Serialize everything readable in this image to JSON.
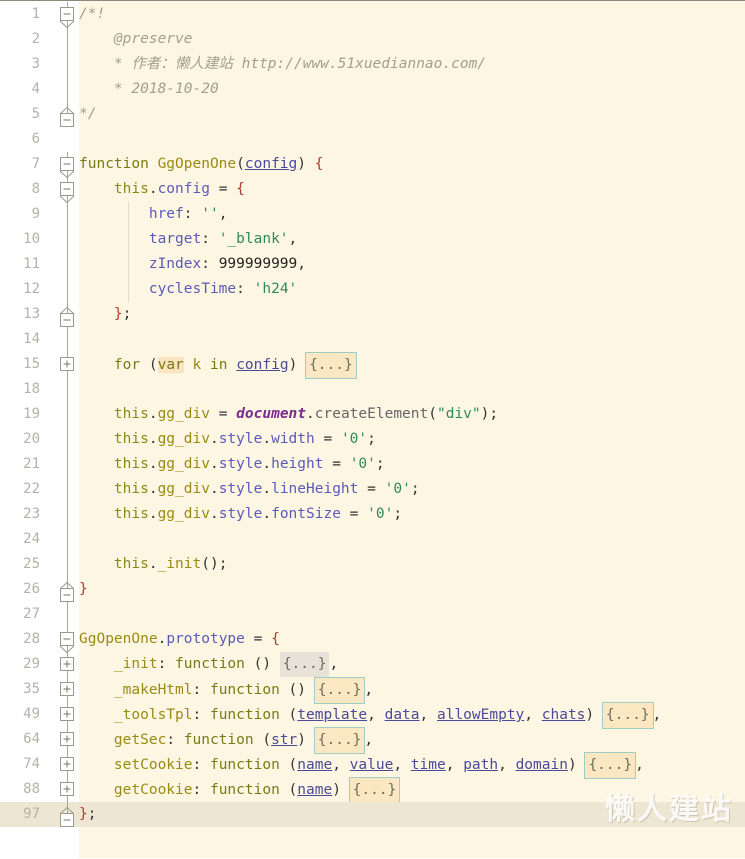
{
  "editor": {
    "watermark": "懒人建站",
    "background": "#FDF6E3",
    "current_line_background": "#EDE6D3",
    "gutter_background": "#FFFFFF",
    "fold_placeholder": "{...}",
    "fold_active_fill": "#FBE7C2",
    "fold_active_border": "#9FCFC2",
    "fold_plain_fill": "#E6E2D8",
    "highlight_identifier_fill": "#FAE3C0"
  },
  "lines": [
    {
      "num": "1",
      "marker": "start",
      "text": "/*!"
    },
    {
      "num": "2",
      "marker": "none",
      "text": "    @preserve"
    },
    {
      "num": "3",
      "marker": "none",
      "text": "    * 作者：懒人建站 http://www.51xuediannao.com/"
    },
    {
      "num": "4",
      "marker": "none",
      "text": "    * 2018-10-20"
    },
    {
      "num": "5",
      "marker": "end",
      "text": "*/"
    },
    {
      "num": "6",
      "marker": "none",
      "text": ""
    },
    {
      "num": "7",
      "marker": "start",
      "text": "function GgOpenOne(config) {"
    },
    {
      "num": "8",
      "marker": "start",
      "text": "    this.config = {"
    },
    {
      "num": "9",
      "marker": "none",
      "text": "        href: '',"
    },
    {
      "num": "10",
      "marker": "none",
      "text": "        target: '_blank',"
    },
    {
      "num": "11",
      "marker": "none",
      "text": "        zIndex: 999999999,"
    },
    {
      "num": "12",
      "marker": "none",
      "text": "        cyclesTime: 'h24'"
    },
    {
      "num": "13",
      "marker": "end",
      "text": "    };"
    },
    {
      "num": "14",
      "marker": "none",
      "text": ""
    },
    {
      "num": "15",
      "marker": "collapsed",
      "text": "    for (var k in config) {...}"
    },
    {
      "num": "18",
      "marker": "none",
      "text": ""
    },
    {
      "num": "19",
      "marker": "none",
      "text": "    this.gg_div = document.createElement(\"div\");"
    },
    {
      "num": "20",
      "marker": "none",
      "text": "    this.gg_div.style.width = '0';"
    },
    {
      "num": "21",
      "marker": "none",
      "text": "    this.gg_div.style.height = '0';"
    },
    {
      "num": "22",
      "marker": "none",
      "text": "    this.gg_div.style.lineHeight = '0';"
    },
    {
      "num": "23",
      "marker": "none",
      "text": "    this.gg_div.style.fontSize = '0';"
    },
    {
      "num": "24",
      "marker": "none",
      "text": ""
    },
    {
      "num": "25",
      "marker": "none",
      "text": "    this._init();"
    },
    {
      "num": "26",
      "marker": "end",
      "text": "}"
    },
    {
      "num": "27",
      "marker": "none",
      "text": ""
    },
    {
      "num": "28",
      "marker": "start",
      "text": "GgOpenOne.prototype = {"
    },
    {
      "num": "29",
      "marker": "collapsed",
      "text": "    _init: function () {...},"
    },
    {
      "num": "35",
      "marker": "collapsed",
      "text": "    _makeHtml: function () {...},"
    },
    {
      "num": "49",
      "marker": "collapsed",
      "text": "    _toolsTpl: function (template, data, allowEmpty, chats) {...},"
    },
    {
      "num": "64",
      "marker": "collapsed",
      "text": "    getSec: function (str) {...},"
    },
    {
      "num": "74",
      "marker": "collapsed",
      "text": "    setCookie: function (name, value, time, path, domain) {...},"
    },
    {
      "num": "88",
      "marker": "collapsed",
      "text": "    getCookie: function (name) {...}"
    },
    {
      "num": "97",
      "marker": "end",
      "text": "};",
      "current": true
    }
  ]
}
